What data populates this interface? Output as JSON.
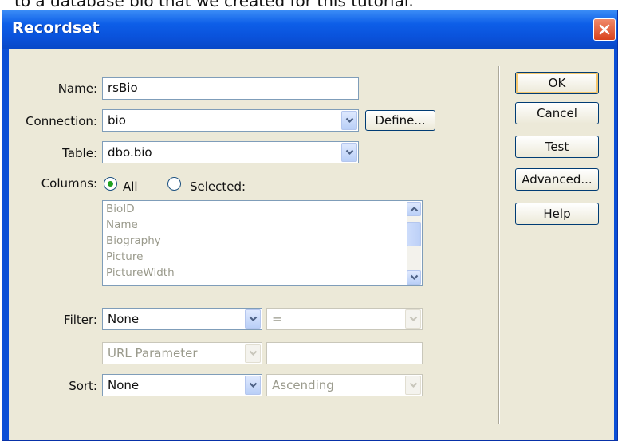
{
  "caption": "to a database bio that we created for this tutorial.",
  "window": {
    "title": "Recordset"
  },
  "form": {
    "name_label": "Name:",
    "name_value": "rsBio",
    "connection_label": "Connection:",
    "connection_value": "bio",
    "define_label": "Define...",
    "table_label": "Table:",
    "table_value": "dbo.bio",
    "columns_label": "Columns:",
    "columns_all_label": "All",
    "columns_selected_label": "Selected:",
    "columns_mode": "All",
    "column_items": [
      "BioID",
      "Name",
      "Biography",
      "Picture",
      "PictureWidth"
    ],
    "filter_label": "Filter:",
    "filter_column": "None",
    "filter_operator": "=",
    "filter_source": "URL Parameter",
    "filter_value": "",
    "sort_label": "Sort:",
    "sort_column": "None",
    "sort_order": "Ascending"
  },
  "buttons": {
    "ok": "OK",
    "cancel": "Cancel",
    "test": "Test",
    "advanced": "Advanced...",
    "help": "Help"
  },
  "icons": {
    "close": "close-icon",
    "dropdown": "chevron-down-icon",
    "scroll_up": "scroll-up-icon",
    "scroll_down": "scroll-down-icon"
  },
  "colors": {
    "titlebar": "#0a52db",
    "client": "#ece9d8",
    "close_button": "#d9431e"
  }
}
